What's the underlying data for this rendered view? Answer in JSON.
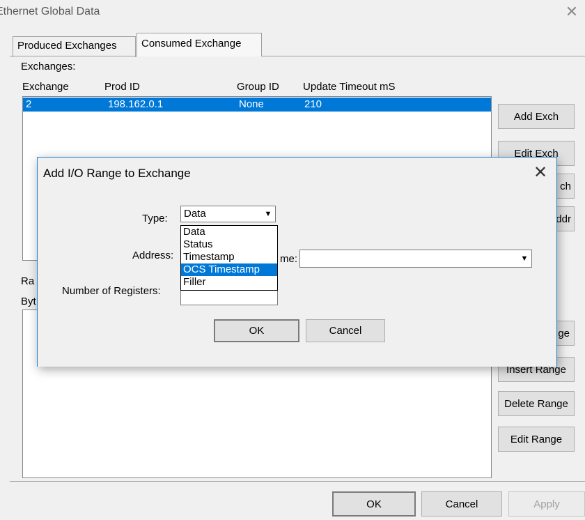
{
  "window": {
    "title": "Ethernet Global Data",
    "close_glyph": "✕"
  },
  "tabs": [
    {
      "label": "Produced Exchanges",
      "active": false
    },
    {
      "label": "Consumed Exchange",
      "active": true
    }
  ],
  "exchanges": {
    "section_label": "Exchanges:",
    "columns": [
      "Exchange",
      "Prod ID",
      "Group ID",
      "Update Timeout mS"
    ],
    "rows": [
      {
        "exchange": "2",
        "prod_id": "198.162.0.1",
        "group_id": "None",
        "update_timeout": "210",
        "selected": true
      }
    ]
  },
  "side_buttons": {
    "add_exch": "Add Exch",
    "edit_exch": "Edit Exch",
    "delete_exch_partial": "ch",
    "address_partial": "ddr",
    "range_partial": "ge",
    "insert_range": "Insert Range",
    "delete_range": "Delete Range",
    "edit_range": "Edit Range"
  },
  "ranges": {
    "section_label_partial": "Ra",
    "column_partial": "Byt"
  },
  "footer": {
    "ok": "OK",
    "cancel": "Cancel",
    "apply": "Apply"
  },
  "dialog": {
    "title": "Add I/O Range to Exchange",
    "close_glyph": "✕",
    "type_label": "Type:",
    "type_value": "Data",
    "address_label": "Address:",
    "name_label_partial": "me:",
    "name_value": "",
    "num_registers_label": "Number of Registers:",
    "type_options": [
      "Data",
      "Status",
      "Timestamp",
      "OCS Timestamp",
      "Filler"
    ],
    "highlighted_option": "OCS Timestamp",
    "ok": "OK",
    "cancel": "Cancel",
    "arrow_glyph": "▼"
  }
}
